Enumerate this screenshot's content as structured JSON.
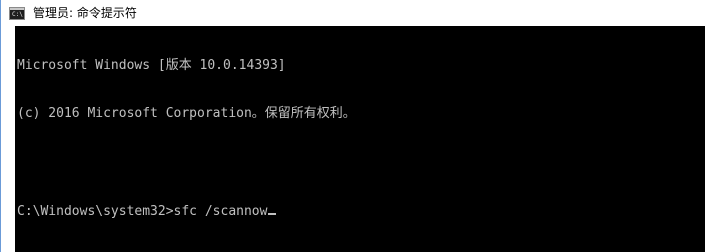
{
  "window": {
    "title": "管理员: 命令提示符",
    "icon": "cmd-icon",
    "icon_glyph": "C:\\"
  },
  "console": {
    "lines": [
      "Microsoft Windows [版本 10.0.14393]",
      "(c) 2016 Microsoft Corporation。保留所有权利。",
      "",
      "C:\\Windows\\system32>sfc /scannow"
    ],
    "background": "#000000",
    "foreground": "#c0c0c0"
  }
}
